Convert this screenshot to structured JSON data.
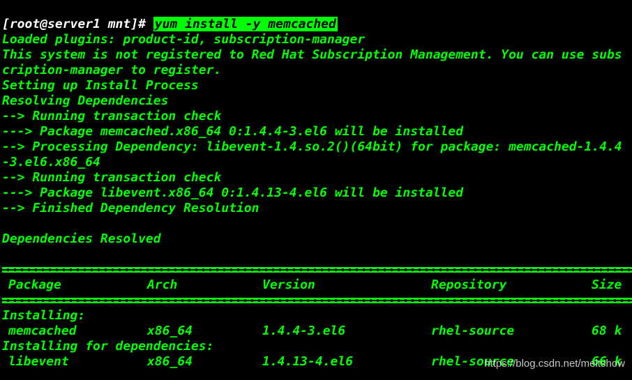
{
  "prompt": "[root@server1 mnt]# ",
  "command": "yum install -y memcached",
  "output_lines": [
    "Loaded plugins: product-id, subscription-manager",
    "This system is not registered to Red Hat Subscription Management. You can use subs",
    "cription-manager to register.",
    "Setting up Install Process",
    "Resolving Dependencies",
    "--> Running transaction check",
    "---> Package memcached.x86_64 0:1.4.4-3.el6 will be installed",
    "--> Processing Dependency: libevent-1.4.so.2()(64bit) for package: memcached-1.4.4",
    "-3.el6.x86_64",
    "--> Running transaction check",
    "---> Package libevent.x86_64 0:1.4.13-4.el6 will be installed",
    "--> Finished Dependency Resolution",
    "",
    "Dependencies Resolved"
  ],
  "table": {
    "headers": {
      "package": "Package",
      "arch": "Arch",
      "version": "Version",
      "repository": "Repository",
      "size": "Size"
    },
    "installing_label": "Installing:",
    "installing": {
      "package": "memcached",
      "arch": "x86_64",
      "version": "1.4.4-3.el6",
      "repository": "rhel-source",
      "size": "68 k"
    },
    "deps_label": "Installing for dependencies:",
    "deps": {
      "package": "libevent",
      "arch": "x86_64",
      "version": "1.4.13-4.el6",
      "repository": "rhel-source",
      "size": "66 k"
    }
  },
  "watermark": "https://blog.csdn.net/meltshow",
  "colors": {
    "background": "#000000",
    "text": "#00ff00",
    "prompt": "#ffffff",
    "command_highlight": "#00ff00"
  }
}
